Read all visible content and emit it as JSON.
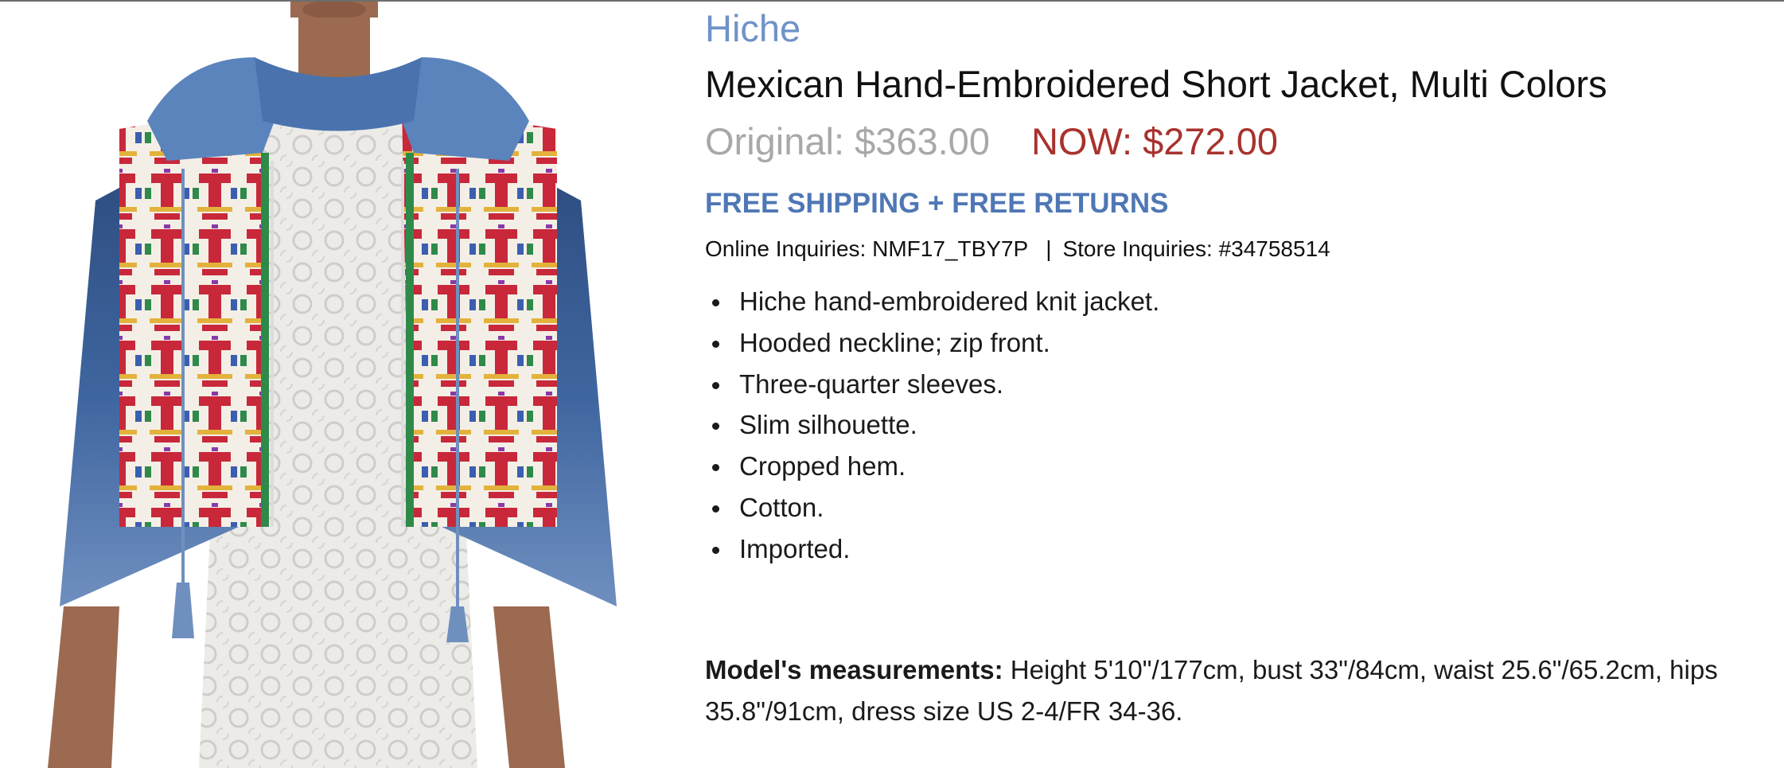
{
  "product": {
    "brand": "Hiche",
    "title": "Mexican Hand-Embroidered Short Jacket, Multi Colors",
    "original_price": "Original: $363.00",
    "now_price": "NOW: $272.00",
    "shipping": "FREE SHIPPING + FREE RETURNS",
    "online_inquiries": "Online Inquiries: NMF17_TBY7P",
    "separator": "|",
    "store_inquiries": "Store Inquiries: #34758514",
    "features": [
      "Hiche hand-embroidered knit jacket.",
      "Hooded neckline; zip front.",
      "Three-quarter sleeves.",
      "Slim silhouette.",
      "Cropped hem.",
      "Cotton.",
      "Imported."
    ],
    "measurements_label": "Model's measurements:",
    "measurements_text": " Height 5'10\"/177cm, bust 33\"/84cm, waist 25.6\"/65.2cm, hips 35.8\"/91cm, dress size US 2-4/FR 34-36."
  },
  "image": {
    "icon": "product-photo",
    "colors": {
      "denim": "#3f66a0",
      "denim_dark": "#2c4a7c",
      "hood": "#5b84bd",
      "embroidery_base": "#f4efe6",
      "embroidery_red": "#c8283a",
      "lace": "#ecebe8",
      "skin": "#9b6a50"
    }
  },
  "colors": {
    "brand": "#6f92c8",
    "original_price": "#a8a8a8",
    "now_price": "#a8322d",
    "shipping": "#4f77b5"
  }
}
